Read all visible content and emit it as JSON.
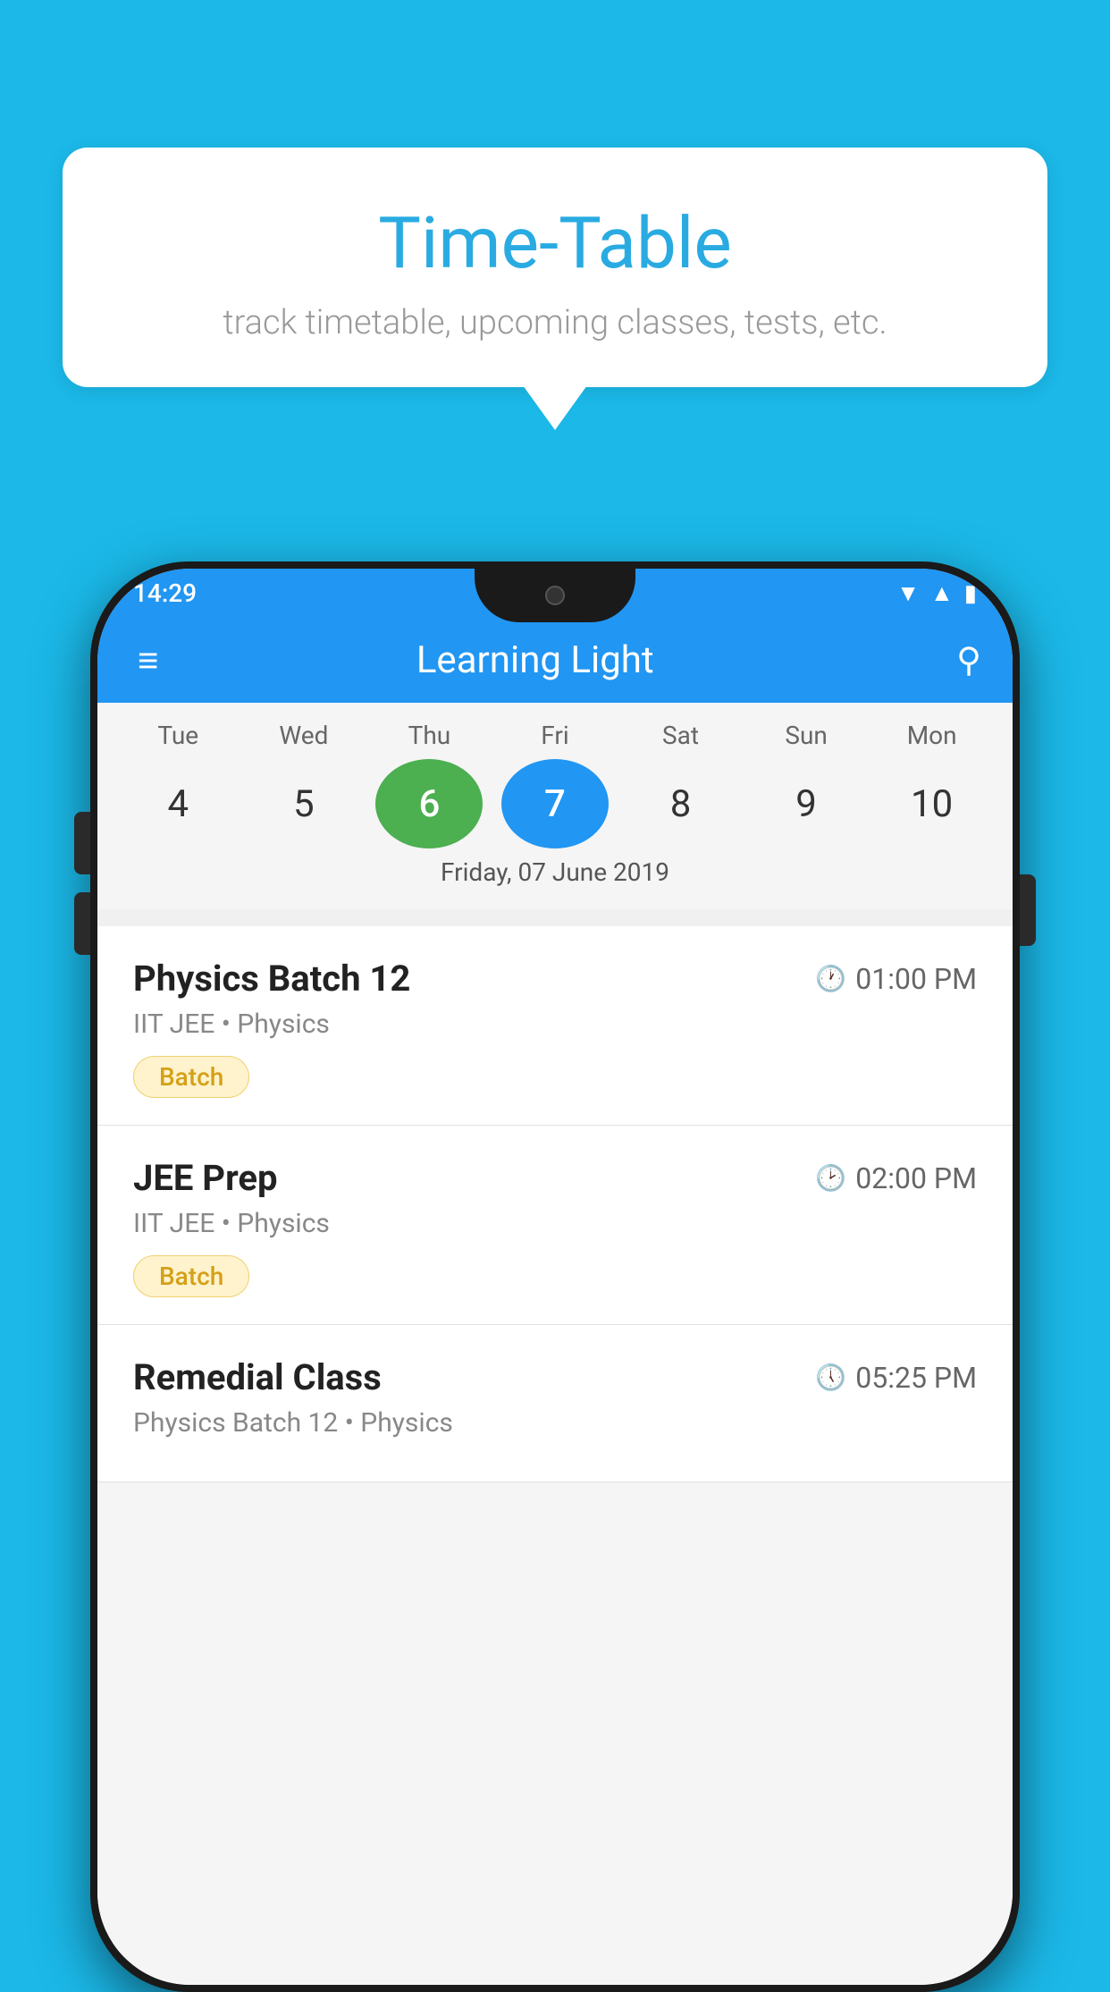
{
  "background_color": "#1BB8E8",
  "tooltip": {
    "title": "Time-Table",
    "subtitle": "track timetable, upcoming classes, tests, etc."
  },
  "status_bar": {
    "time": "14:29",
    "wifi": "▼",
    "signal": "▲",
    "battery": "▌"
  },
  "app_bar": {
    "title": "Learning Light",
    "menu_icon": "≡",
    "search_icon": "🔍"
  },
  "calendar": {
    "days": [
      {
        "label": "Tue",
        "number": "4"
      },
      {
        "label": "Wed",
        "number": "5"
      },
      {
        "label": "Thu",
        "number": "6",
        "state": "today"
      },
      {
        "label": "Fri",
        "number": "7",
        "state": "selected"
      },
      {
        "label": "Sat",
        "number": "8"
      },
      {
        "label": "Sun",
        "number": "9"
      },
      {
        "label": "Mon",
        "number": "10"
      }
    ],
    "selected_date_label": "Friday, 07 June 2019"
  },
  "schedule": {
    "items": [
      {
        "title": "Physics Batch 12",
        "time": "01:00 PM",
        "subtitle": "IIT JEE • Physics",
        "badge": "Batch"
      },
      {
        "title": "JEE Prep",
        "time": "02:00 PM",
        "subtitle": "IIT JEE • Physics",
        "badge": "Batch"
      },
      {
        "title": "Remedial Class",
        "time": "05:25 PM",
        "subtitle": "Physics Batch 12 • Physics",
        "badge": null
      }
    ]
  }
}
